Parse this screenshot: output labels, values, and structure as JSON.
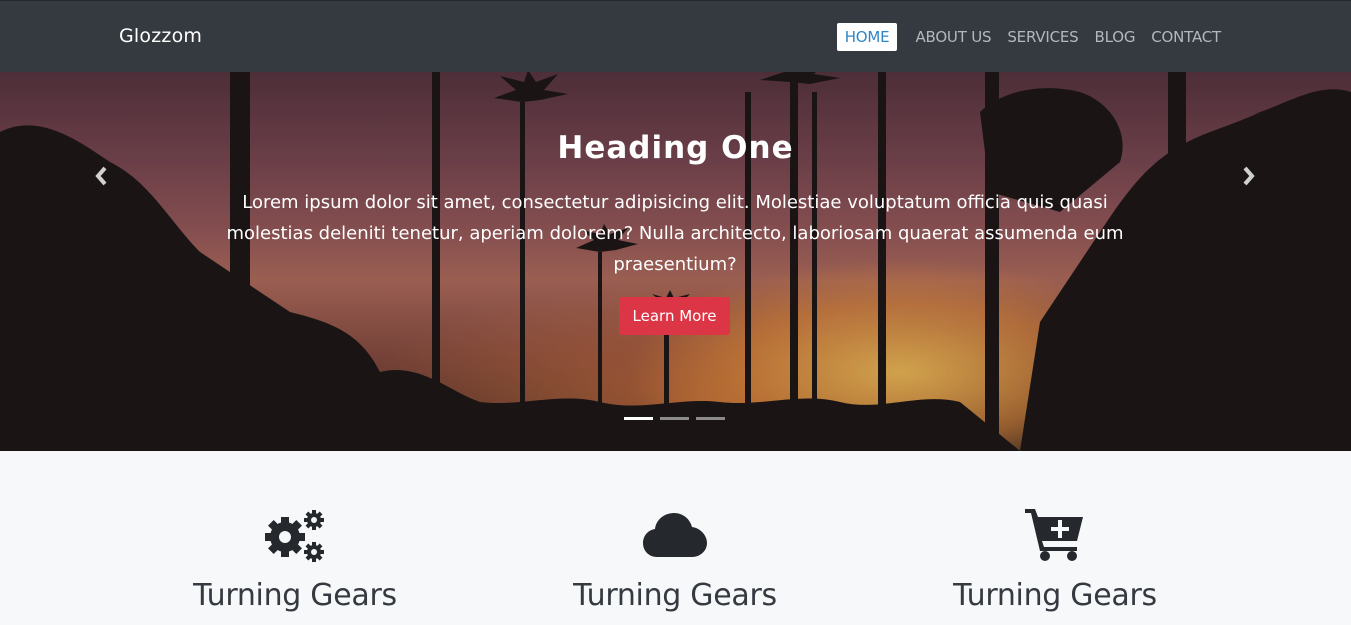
{
  "navbar": {
    "brand": "Glozzom",
    "links": [
      {
        "label": "HOME",
        "active": true
      },
      {
        "label": "ABOUT US",
        "active": false
      },
      {
        "label": "SERVICES",
        "active": false
      },
      {
        "label": "BLOG",
        "active": false
      },
      {
        "label": "CONTACT",
        "active": false
      }
    ]
  },
  "hero": {
    "heading": "Heading One",
    "text": "Lorem ipsum dolor sit amet, consectetur adipisicing elit. Molestiae voluptatum officia quis quasi molestias deleniti tenetur, aperiam dolorem? Nulla architecto, laboriosam quaerat assumenda eum praesentium?",
    "button_label": "Learn More",
    "prev_icon": "chevron-left-icon",
    "next_icon": "chevron-right-icon",
    "slides": 3,
    "active_slide": 1
  },
  "features": [
    {
      "icon": "cogs-icon",
      "title": "Turning Gears"
    },
    {
      "icon": "cloud-icon",
      "title": "Turning Gears"
    },
    {
      "icon": "cart-plus-icon",
      "title": "Turning Gears"
    }
  ],
  "colors": {
    "navbar_bg": "#343a40",
    "active_link": "#2f86c7",
    "button_bg": "#dc3545",
    "icon_color": "#25292e"
  }
}
